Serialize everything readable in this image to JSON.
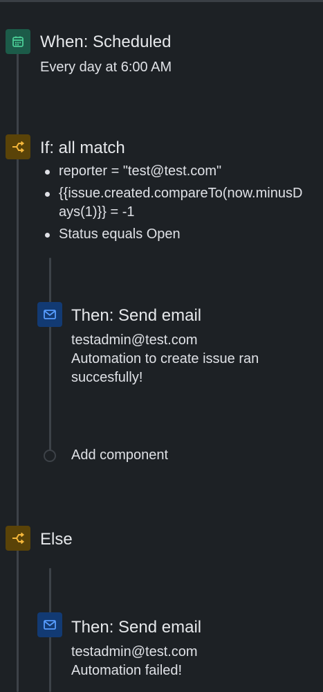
{
  "trigger": {
    "title": "When: Scheduled",
    "detail": "Every day at 6:00 AM",
    "icon": "calendar-icon",
    "color": "#1c5b49"
  },
  "condition": {
    "title": "If: all match",
    "icon": "branch-icon",
    "color": "#5a4308",
    "items": [
      "reporter = \"test@test.com\"",
      "{{issue.created.compareTo(now.minusDays(1)}} = -1",
      "Status equals Open"
    ],
    "then_action": {
      "title": "Then: Send email",
      "icon": "mail-icon",
      "color": "#123a73",
      "recipient": "testadmin@test.com",
      "message": "Automation to create issue ran succesfully!"
    },
    "add_component_label": "Add component"
  },
  "else_branch": {
    "title": "Else",
    "icon": "branch-icon",
    "then_action": {
      "title": "Then: Send email",
      "icon": "mail-icon",
      "recipient": "testadmin@test.com",
      "message": "Automation failed!"
    }
  }
}
